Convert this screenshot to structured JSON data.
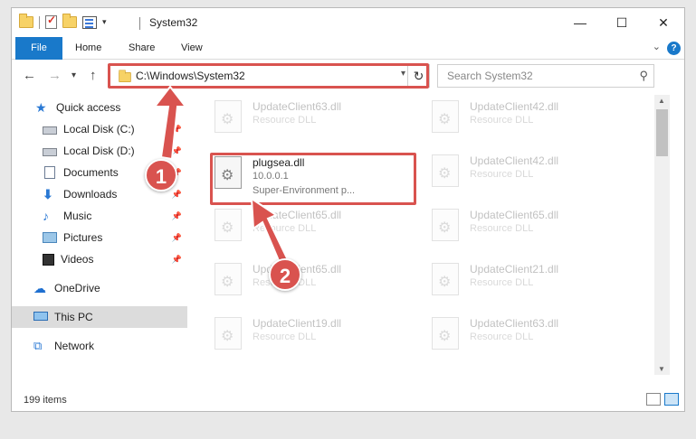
{
  "window": {
    "title": "System32",
    "controls": {
      "minimize": "—",
      "maximize": "☐",
      "close": "✕"
    }
  },
  "ribbon": {
    "tabs": [
      "File",
      "Home",
      "Share",
      "View"
    ],
    "help": "?"
  },
  "navigation": {
    "back": "←",
    "forward": "→",
    "recent": "▾",
    "up": "↑",
    "address": "C:\\Windows\\System32",
    "search_placeholder": "Search System32"
  },
  "sidebar": {
    "items": [
      {
        "label": "Quick access",
        "icon": "star-icon",
        "pinned": false
      },
      {
        "label": "Local Disk (C:)",
        "icon": "disk-icon",
        "pinned": true
      },
      {
        "label": "Local Disk (D:)",
        "icon": "disk-icon",
        "pinned": true
      },
      {
        "label": "Documents",
        "icon": "documents-icon",
        "pinned": true
      },
      {
        "label": "Downloads",
        "icon": "download-icon",
        "pinned": true
      },
      {
        "label": "Music",
        "icon": "music-icon",
        "pinned": true
      },
      {
        "label": "Pictures",
        "icon": "pictures-icon",
        "pinned": true
      },
      {
        "label": "Videos",
        "icon": "videos-icon",
        "pinned": true
      },
      {
        "label": "OneDrive",
        "icon": "cloud-icon",
        "pinned": false
      },
      {
        "label": "This PC",
        "icon": "computer-icon",
        "pinned": false,
        "selected": true
      },
      {
        "label": "Network",
        "icon": "network-icon",
        "pinned": false
      }
    ]
  },
  "files": {
    "left": [
      {
        "name": "UpdateClient63.dll",
        "type": "Resource DLL"
      },
      {
        "name": "plugsea.dll",
        "type": "10.0.0.1",
        "description": "Super-Environment p...",
        "highlighted": true
      },
      {
        "name": "UpdateClient65.dll",
        "type": "Resource DLL"
      },
      {
        "name": "UpdateClient65.dll",
        "type": "Resource DLL"
      },
      {
        "name": "UpdateClient19.dll",
        "type": "Resource DLL"
      }
    ],
    "right": [
      {
        "name": "UpdateClient42.dll",
        "type": "Resource DLL"
      },
      {
        "name": "UpdateClient42.dll",
        "type": "Resource DLL"
      },
      {
        "name": "UpdateClient65.dll",
        "type": "Resource DLL"
      },
      {
        "name": "UpdateClient21.dll",
        "type": "Resource DLL"
      },
      {
        "name": "UpdateClient63.dll",
        "type": "Resource DLL"
      }
    ]
  },
  "status": {
    "item_count": "199 items"
  },
  "annotations": {
    "step1": "1",
    "step2": "2",
    "color": "#d9534f"
  }
}
